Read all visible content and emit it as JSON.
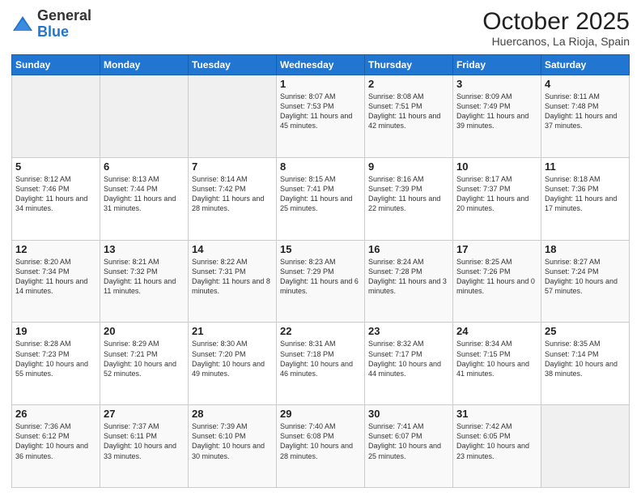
{
  "logo": {
    "general": "General",
    "blue": "Blue"
  },
  "title": "October 2025",
  "subtitle": "Huercanos, La Rioja, Spain",
  "days_of_week": [
    "Sunday",
    "Monday",
    "Tuesday",
    "Wednesday",
    "Thursday",
    "Friday",
    "Saturday"
  ],
  "weeks": [
    [
      {
        "day": "",
        "info": ""
      },
      {
        "day": "",
        "info": ""
      },
      {
        "day": "",
        "info": ""
      },
      {
        "day": "1",
        "info": "Sunrise: 8:07 AM\nSunset: 7:53 PM\nDaylight: 11 hours and 45 minutes."
      },
      {
        "day": "2",
        "info": "Sunrise: 8:08 AM\nSunset: 7:51 PM\nDaylight: 11 hours and 42 minutes."
      },
      {
        "day": "3",
        "info": "Sunrise: 8:09 AM\nSunset: 7:49 PM\nDaylight: 11 hours and 39 minutes."
      },
      {
        "day": "4",
        "info": "Sunrise: 8:11 AM\nSunset: 7:48 PM\nDaylight: 11 hours and 37 minutes."
      }
    ],
    [
      {
        "day": "5",
        "info": "Sunrise: 8:12 AM\nSunset: 7:46 PM\nDaylight: 11 hours and 34 minutes."
      },
      {
        "day": "6",
        "info": "Sunrise: 8:13 AM\nSunset: 7:44 PM\nDaylight: 11 hours and 31 minutes."
      },
      {
        "day": "7",
        "info": "Sunrise: 8:14 AM\nSunset: 7:42 PM\nDaylight: 11 hours and 28 minutes."
      },
      {
        "day": "8",
        "info": "Sunrise: 8:15 AM\nSunset: 7:41 PM\nDaylight: 11 hours and 25 minutes."
      },
      {
        "day": "9",
        "info": "Sunrise: 8:16 AM\nSunset: 7:39 PM\nDaylight: 11 hours and 22 minutes."
      },
      {
        "day": "10",
        "info": "Sunrise: 8:17 AM\nSunset: 7:37 PM\nDaylight: 11 hours and 20 minutes."
      },
      {
        "day": "11",
        "info": "Sunrise: 8:18 AM\nSunset: 7:36 PM\nDaylight: 11 hours and 17 minutes."
      }
    ],
    [
      {
        "day": "12",
        "info": "Sunrise: 8:20 AM\nSunset: 7:34 PM\nDaylight: 11 hours and 14 minutes."
      },
      {
        "day": "13",
        "info": "Sunrise: 8:21 AM\nSunset: 7:32 PM\nDaylight: 11 hours and 11 minutes."
      },
      {
        "day": "14",
        "info": "Sunrise: 8:22 AM\nSunset: 7:31 PM\nDaylight: 11 hours and 8 minutes."
      },
      {
        "day": "15",
        "info": "Sunrise: 8:23 AM\nSunset: 7:29 PM\nDaylight: 11 hours and 6 minutes."
      },
      {
        "day": "16",
        "info": "Sunrise: 8:24 AM\nSunset: 7:28 PM\nDaylight: 11 hours and 3 minutes."
      },
      {
        "day": "17",
        "info": "Sunrise: 8:25 AM\nSunset: 7:26 PM\nDaylight: 11 hours and 0 minutes."
      },
      {
        "day": "18",
        "info": "Sunrise: 8:27 AM\nSunset: 7:24 PM\nDaylight: 10 hours and 57 minutes."
      }
    ],
    [
      {
        "day": "19",
        "info": "Sunrise: 8:28 AM\nSunset: 7:23 PM\nDaylight: 10 hours and 55 minutes."
      },
      {
        "day": "20",
        "info": "Sunrise: 8:29 AM\nSunset: 7:21 PM\nDaylight: 10 hours and 52 minutes."
      },
      {
        "day": "21",
        "info": "Sunrise: 8:30 AM\nSunset: 7:20 PM\nDaylight: 10 hours and 49 minutes."
      },
      {
        "day": "22",
        "info": "Sunrise: 8:31 AM\nSunset: 7:18 PM\nDaylight: 10 hours and 46 minutes."
      },
      {
        "day": "23",
        "info": "Sunrise: 8:32 AM\nSunset: 7:17 PM\nDaylight: 10 hours and 44 minutes."
      },
      {
        "day": "24",
        "info": "Sunrise: 8:34 AM\nSunset: 7:15 PM\nDaylight: 10 hours and 41 minutes."
      },
      {
        "day": "25",
        "info": "Sunrise: 8:35 AM\nSunset: 7:14 PM\nDaylight: 10 hours and 38 minutes."
      }
    ],
    [
      {
        "day": "26",
        "info": "Sunrise: 7:36 AM\nSunset: 6:12 PM\nDaylight: 10 hours and 36 minutes."
      },
      {
        "day": "27",
        "info": "Sunrise: 7:37 AM\nSunset: 6:11 PM\nDaylight: 10 hours and 33 minutes."
      },
      {
        "day": "28",
        "info": "Sunrise: 7:39 AM\nSunset: 6:10 PM\nDaylight: 10 hours and 30 minutes."
      },
      {
        "day": "29",
        "info": "Sunrise: 7:40 AM\nSunset: 6:08 PM\nDaylight: 10 hours and 28 minutes."
      },
      {
        "day": "30",
        "info": "Sunrise: 7:41 AM\nSunset: 6:07 PM\nDaylight: 10 hours and 25 minutes."
      },
      {
        "day": "31",
        "info": "Sunrise: 7:42 AM\nSunset: 6:05 PM\nDaylight: 10 hours and 23 minutes."
      },
      {
        "day": "",
        "info": ""
      }
    ]
  ]
}
